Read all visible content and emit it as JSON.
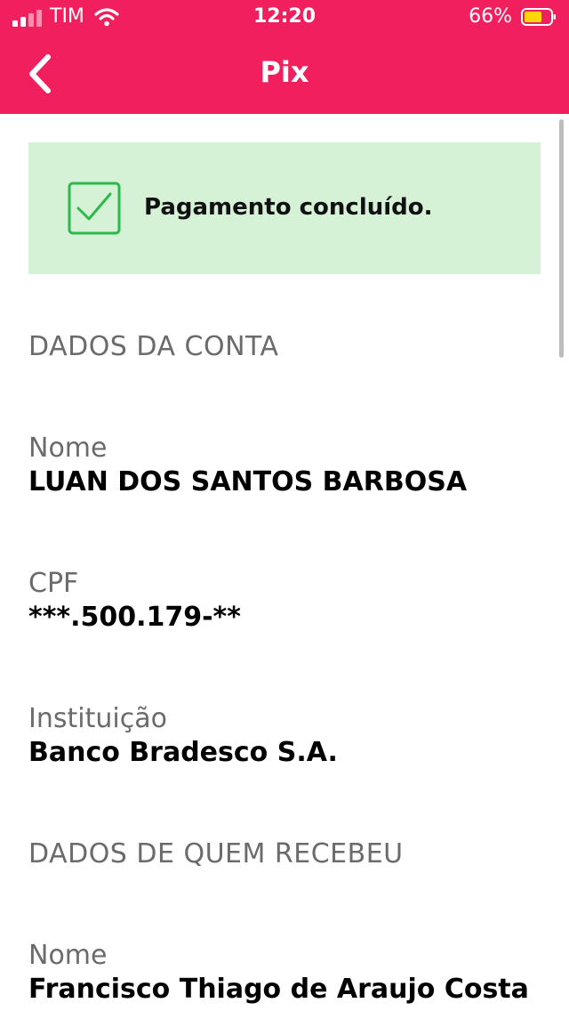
{
  "status_bar": {
    "carrier": "TIM",
    "time": "12:20",
    "battery_percent": "66%"
  },
  "nav": {
    "title": "Pix"
  },
  "success_banner": {
    "text": "Pagamento concluído."
  },
  "account_section": {
    "title": "DADOS DA CONTA",
    "name_label": "Nome",
    "name_value": "LUAN DOS SANTOS BARBOSA",
    "cpf_label": "CPF",
    "cpf_value": "***.500.179-**",
    "institution_label": "Instituição",
    "institution_value": "Banco Bradesco S.A."
  },
  "recipient_section": {
    "title": "DADOS DE QUEM RECEBEU",
    "name_label": "Nome",
    "name_value": "Francisco Thiago de Araujo Costa"
  },
  "colors": {
    "header": "#f21f5e",
    "success_bg": "#d5f2d6",
    "success_icon": "#2eb84b",
    "battery_fill": "#ffd60a"
  },
  "icons": [
    "signal-icon",
    "wifi-icon",
    "battery-icon",
    "back-chevron-icon",
    "check-icon"
  ]
}
